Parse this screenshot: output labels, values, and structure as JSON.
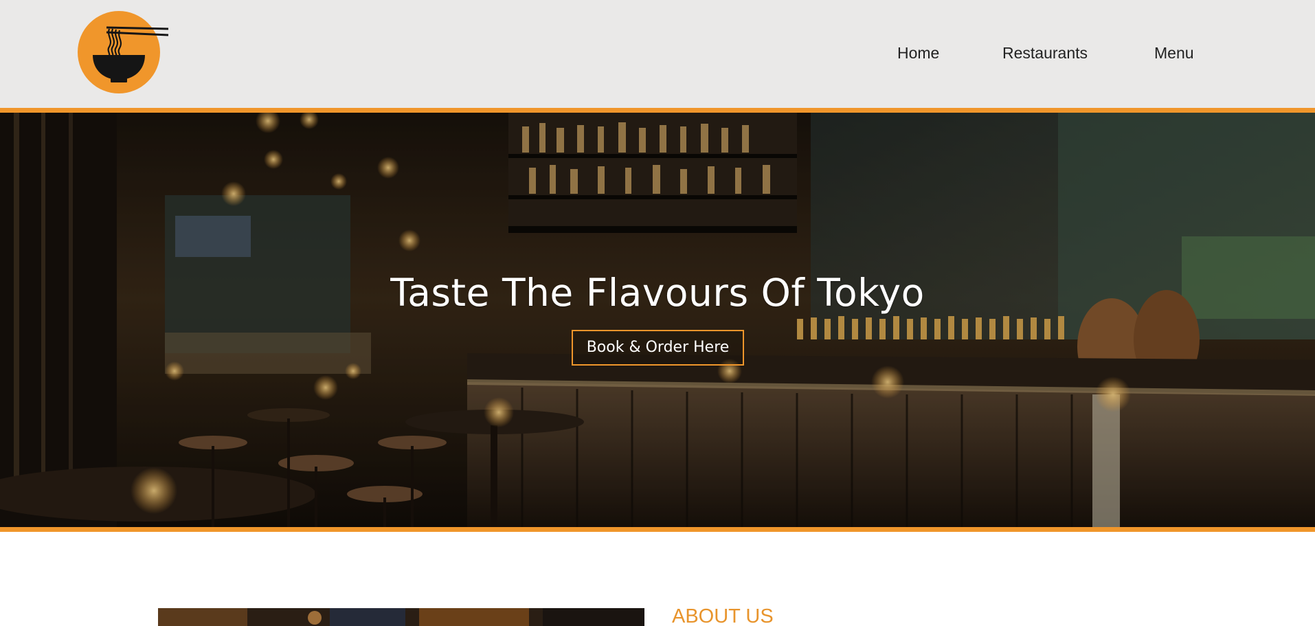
{
  "colors": {
    "accent": "#f0962b",
    "header_bg": "#eae9e8",
    "about_heading": "#e8942c",
    "nav_text": "#222222"
  },
  "logo": {
    "icon": "noodle-bowl-chopsticks-icon"
  },
  "nav": {
    "items": [
      {
        "label": "Home"
      },
      {
        "label": "Restaurants"
      },
      {
        "label": "Menu"
      }
    ]
  },
  "hero": {
    "title": "Taste The Flavours Of Tokyo",
    "button_label": "Book & Order Here",
    "image": "restaurant-bar-interior"
  },
  "about": {
    "heading": "ABOUT US"
  }
}
